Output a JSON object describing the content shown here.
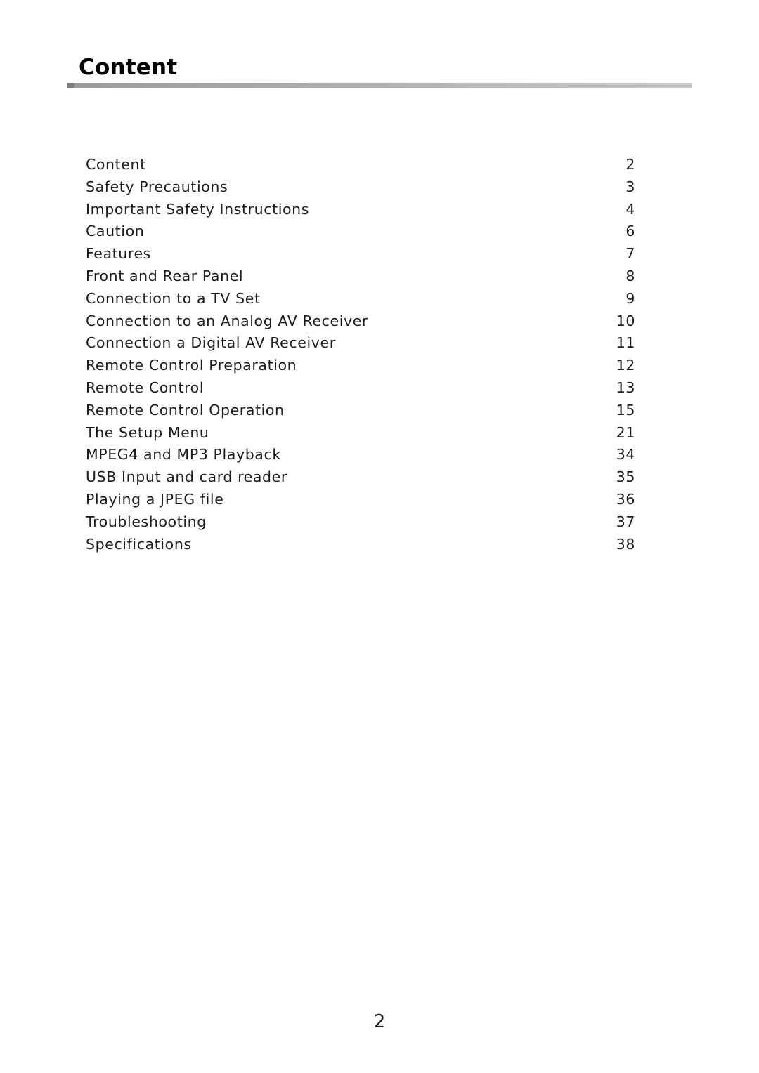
{
  "heading": {
    "title": "Content"
  },
  "toc": {
    "entries": [
      {
        "label": "Content",
        "page": "2"
      },
      {
        "label": "Safety Precautions",
        "page": "3"
      },
      {
        "label": "Important Safety Instructions",
        "page": "4"
      },
      {
        "label": "Caution",
        "page": "6"
      },
      {
        "label": "Features",
        "page": "7"
      },
      {
        "label": "Front and Rear Panel",
        "page": "8"
      },
      {
        "label": "Connection to a TV Set",
        "page": "9"
      },
      {
        "label": "Connection to an Analog AV Receiver",
        "page": "10"
      },
      {
        "label": "Connection a Digital AV Receiver",
        "page": "11"
      },
      {
        "label": "Remote Control Preparation",
        "page": "12"
      },
      {
        "label": "Remote Control",
        "page": "13"
      },
      {
        "label": "Remote Control Operation",
        "page": "15"
      },
      {
        "label": "The Setup Menu",
        "page": "21"
      },
      {
        "label": "MPEG4 and MP3 Playback",
        "page": "34"
      },
      {
        "label": "USB Input and card reader",
        "page": "35"
      },
      {
        "label": "Playing a JPEG file",
        "page": "36"
      },
      {
        "label": "Troubleshooting",
        "page": "37"
      },
      {
        "label": "Specifications",
        "page": "38"
      }
    ]
  },
  "footer": {
    "page_number": "2"
  }
}
